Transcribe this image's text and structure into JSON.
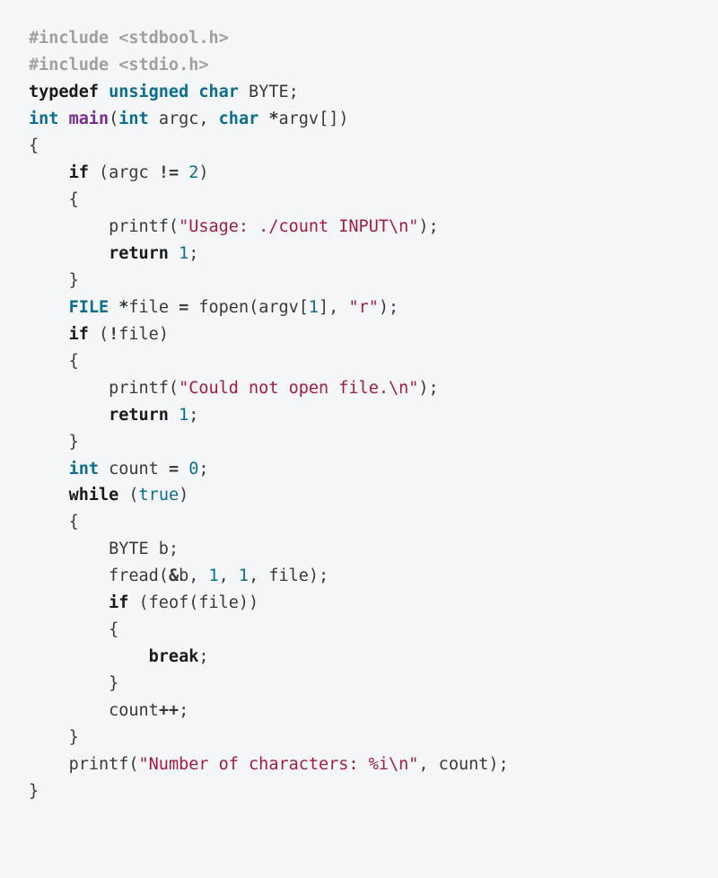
{
  "code": {
    "lines": [
      {
        "indent": 0,
        "tokens": [
          {
            "t": "#include <stdbool.h>",
            "c": "preproc"
          }
        ]
      },
      {
        "indent": 0,
        "tokens": [
          {
            "t": "#include <stdio.h>",
            "c": "preproc"
          }
        ]
      },
      {
        "indent": 0,
        "tokens": [
          {
            "t": "typedef",
            "c": "keyword"
          },
          {
            "t": " ",
            "c": "ident"
          },
          {
            "t": "unsigned",
            "c": "type"
          },
          {
            "t": " ",
            "c": "ident"
          },
          {
            "t": "char",
            "c": "type"
          },
          {
            "t": " BYTE",
            "c": "ident"
          },
          {
            "t": ";",
            "c": "punct"
          }
        ]
      },
      {
        "indent": 0,
        "tokens": [
          {
            "t": "int",
            "c": "type"
          },
          {
            "t": " ",
            "c": "ident"
          },
          {
            "t": "main",
            "c": "func"
          },
          {
            "t": "(",
            "c": "punct"
          },
          {
            "t": "int",
            "c": "type"
          },
          {
            "t": " argc",
            "c": "ident"
          },
          {
            "t": ", ",
            "c": "punct"
          },
          {
            "t": "char",
            "c": "type"
          },
          {
            "t": " ",
            "c": "ident"
          },
          {
            "t": "*",
            "c": "op"
          },
          {
            "t": "argv",
            "c": "ident"
          },
          {
            "t": "[])",
            "c": "punct"
          }
        ]
      },
      {
        "indent": 0,
        "tokens": [
          {
            "t": "{",
            "c": "punct"
          }
        ]
      },
      {
        "indent": 1,
        "tokens": [
          {
            "t": "if",
            "c": "keyword"
          },
          {
            "t": " (argc ",
            "c": "ident"
          },
          {
            "t": "!=",
            "c": "op"
          },
          {
            "t": " ",
            "c": "ident"
          },
          {
            "t": "2",
            "c": "num"
          },
          {
            "t": ")",
            "c": "punct"
          }
        ]
      },
      {
        "indent": 1,
        "tokens": [
          {
            "t": "{",
            "c": "punct"
          }
        ]
      },
      {
        "indent": 2,
        "tokens": [
          {
            "t": "printf(",
            "c": "ident"
          },
          {
            "t": "\"Usage: ./count INPUT\\n\"",
            "c": "string"
          },
          {
            "t": ");",
            "c": "punct"
          }
        ]
      },
      {
        "indent": 2,
        "tokens": [
          {
            "t": "return",
            "c": "keyword"
          },
          {
            "t": " ",
            "c": "ident"
          },
          {
            "t": "1",
            "c": "num"
          },
          {
            "t": ";",
            "c": "punct"
          }
        ]
      },
      {
        "indent": 1,
        "tokens": [
          {
            "t": "}",
            "c": "punct"
          }
        ]
      },
      {
        "indent": 1,
        "tokens": [
          {
            "t": "FILE",
            "c": "type"
          },
          {
            "t": " ",
            "c": "ident"
          },
          {
            "t": "*",
            "c": "op"
          },
          {
            "t": "file ",
            "c": "ident"
          },
          {
            "t": "=",
            "c": "op"
          },
          {
            "t": " fopen(argv[",
            "c": "ident"
          },
          {
            "t": "1",
            "c": "num"
          },
          {
            "t": "], ",
            "c": "ident"
          },
          {
            "t": "\"r\"",
            "c": "string"
          },
          {
            "t": ");",
            "c": "punct"
          }
        ]
      },
      {
        "indent": 1,
        "tokens": [
          {
            "t": "if",
            "c": "keyword"
          },
          {
            "t": " (",
            "c": "punct"
          },
          {
            "t": "!",
            "c": "op"
          },
          {
            "t": "file)",
            "c": "ident"
          }
        ]
      },
      {
        "indent": 1,
        "tokens": [
          {
            "t": "{",
            "c": "punct"
          }
        ]
      },
      {
        "indent": 2,
        "tokens": [
          {
            "t": "printf(",
            "c": "ident"
          },
          {
            "t": "\"Could not open file.\\n\"",
            "c": "string"
          },
          {
            "t": ");",
            "c": "punct"
          }
        ]
      },
      {
        "indent": 2,
        "tokens": [
          {
            "t": "return",
            "c": "keyword"
          },
          {
            "t": " ",
            "c": "ident"
          },
          {
            "t": "1",
            "c": "num"
          },
          {
            "t": ";",
            "c": "punct"
          }
        ]
      },
      {
        "indent": 1,
        "tokens": [
          {
            "t": "}",
            "c": "punct"
          }
        ]
      },
      {
        "indent": 1,
        "tokens": [
          {
            "t": "int",
            "c": "type"
          },
          {
            "t": " count ",
            "c": "ident"
          },
          {
            "t": "=",
            "c": "op"
          },
          {
            "t": " ",
            "c": "ident"
          },
          {
            "t": "0",
            "c": "num"
          },
          {
            "t": ";",
            "c": "punct"
          }
        ]
      },
      {
        "indent": 1,
        "tokens": [
          {
            "t": "while",
            "c": "keyword"
          },
          {
            "t": " (",
            "c": "punct"
          },
          {
            "t": "true",
            "c": "const"
          },
          {
            "t": ")",
            "c": "punct"
          }
        ]
      },
      {
        "indent": 1,
        "tokens": [
          {
            "t": "{",
            "c": "punct"
          }
        ]
      },
      {
        "indent": 2,
        "tokens": [
          {
            "t": "BYTE b;",
            "c": "ident"
          }
        ]
      },
      {
        "indent": 2,
        "tokens": [
          {
            "t": "fread(",
            "c": "ident"
          },
          {
            "t": "&",
            "c": "op"
          },
          {
            "t": "b, ",
            "c": "ident"
          },
          {
            "t": "1",
            "c": "num"
          },
          {
            "t": ", ",
            "c": "ident"
          },
          {
            "t": "1",
            "c": "num"
          },
          {
            "t": ", file);",
            "c": "ident"
          }
        ]
      },
      {
        "indent": 2,
        "tokens": [
          {
            "t": "if",
            "c": "keyword"
          },
          {
            "t": " (feof(file))",
            "c": "ident"
          }
        ]
      },
      {
        "indent": 2,
        "tokens": [
          {
            "t": "{",
            "c": "punct"
          }
        ]
      },
      {
        "indent": 3,
        "tokens": [
          {
            "t": "break",
            "c": "keyword"
          },
          {
            "t": ";",
            "c": "punct"
          }
        ]
      },
      {
        "indent": 2,
        "tokens": [
          {
            "t": "}",
            "c": "punct"
          }
        ]
      },
      {
        "indent": 2,
        "tokens": [
          {
            "t": "count",
            "c": "ident"
          },
          {
            "t": "++",
            "c": "op"
          },
          {
            "t": ";",
            "c": "punct"
          }
        ]
      },
      {
        "indent": 1,
        "tokens": [
          {
            "t": "}",
            "c": "punct"
          }
        ]
      },
      {
        "indent": 1,
        "tokens": [
          {
            "t": "printf(",
            "c": "ident"
          },
          {
            "t": "\"Number of characters: %i\\n\"",
            "c": "string"
          },
          {
            "t": ", count);",
            "c": "ident"
          }
        ]
      },
      {
        "indent": 0,
        "tokens": [
          {
            "t": "}",
            "c": "punct"
          }
        ]
      }
    ]
  },
  "indent_unit": "    "
}
